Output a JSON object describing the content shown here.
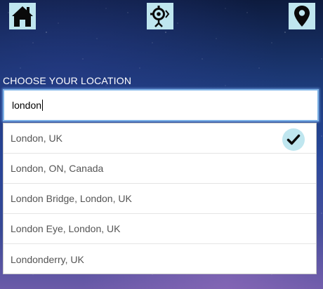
{
  "nav": {
    "home_icon": "home-icon",
    "target_icon": "crosshair-person-icon",
    "pin_icon": "map-pin-icon",
    "icon_bg": "#bfe6ef"
  },
  "location": {
    "label": "CHOOSE YOUR LOCATION",
    "input_value": "london"
  },
  "suggestions": [
    {
      "label": "London, UK",
      "selected": true
    },
    {
      "label": "London, ON, Canada",
      "selected": false
    },
    {
      "label": "London Bridge, London, UK",
      "selected": false
    },
    {
      "label": "London Eye, London, UK",
      "selected": false
    },
    {
      "label": "Londonderry, UK",
      "selected": false
    }
  ],
  "check_icon": "checkmark-icon"
}
